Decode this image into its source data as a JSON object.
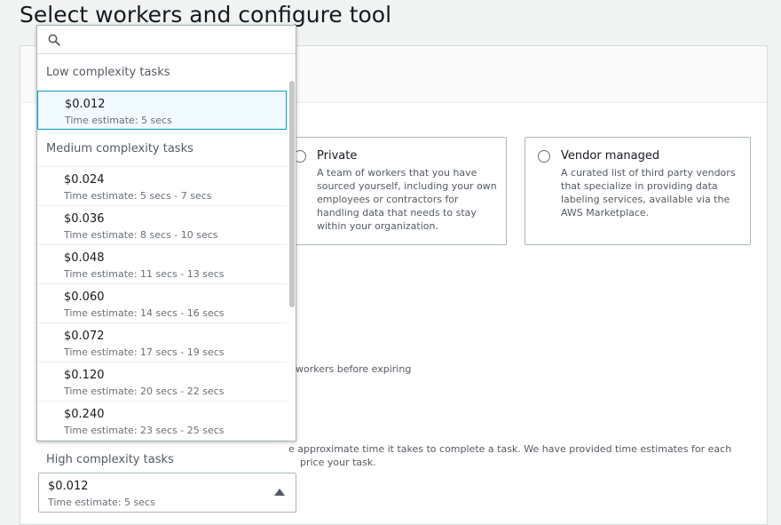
{
  "page": {
    "title": "Select workers and configure tool"
  },
  "worker_types": [
    {
      "title": "Private",
      "description": "A team of workers that you have sourced yourself, including your own employees or contractors for handling data that needs to stay within your organization."
    },
    {
      "title": "Vendor managed",
      "description": "A curated list of third party vendors that specialize in providing data labeling services, available via the AWS Marketplace."
    }
  ],
  "helper_texts": {
    "expiring": "workers before expiring",
    "pricing_line1": "e approximate time it takes to complete a task. We have provided time estimates for each",
    "pricing_line2": "price your task."
  },
  "dropdown": {
    "search_placeholder": "",
    "groups": [
      {
        "label": "Low complexity tasks",
        "options": [
          {
            "price": "$0.012",
            "estimate": "Time estimate: 5 secs",
            "selected": true
          }
        ]
      },
      {
        "label": "Medium complexity tasks",
        "options": [
          {
            "price": "$0.024",
            "estimate": "Time estimate: 5 secs - 7 secs"
          },
          {
            "price": "$0.036",
            "estimate": "Time estimate: 8 secs - 10 secs"
          },
          {
            "price": "$0.048",
            "estimate": "Time estimate: 11 secs - 13 secs"
          },
          {
            "price": "$0.060",
            "estimate": "Time estimate: 14 secs - 16 secs"
          },
          {
            "price": "$0.072",
            "estimate": "Time estimate: 17 secs - 19 secs"
          },
          {
            "price": "$0.120",
            "estimate": "Time estimate: 20 secs - 22 secs"
          },
          {
            "price": "$0.240",
            "estimate": "Time estimate: 23 secs - 25 secs"
          }
        ]
      },
      {
        "label": "High complexity tasks",
        "options": []
      }
    ]
  },
  "select": {
    "price": "$0.012",
    "estimate": "Time estimate: 5 secs"
  },
  "colors": {
    "selected_border": "#00a1c9",
    "selected_bg": "#f1faff"
  }
}
